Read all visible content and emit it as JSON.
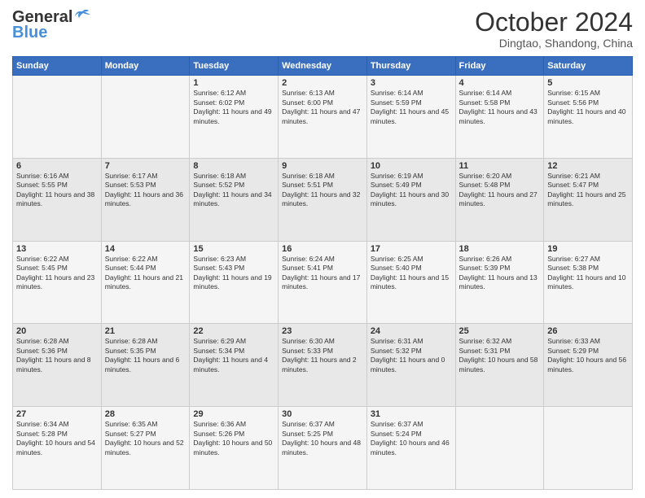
{
  "header": {
    "logo_line1": "General",
    "logo_line2": "Blue",
    "month_title": "October 2024",
    "location": "Dingtao, Shandong, China"
  },
  "days_of_week": [
    "Sunday",
    "Monday",
    "Tuesday",
    "Wednesday",
    "Thursday",
    "Friday",
    "Saturday"
  ],
  "weeks": [
    [
      {
        "day": "",
        "info": ""
      },
      {
        "day": "",
        "info": ""
      },
      {
        "day": "1",
        "info": "Sunrise: 6:12 AM\nSunset: 6:02 PM\nDaylight: 11 hours and 49 minutes."
      },
      {
        "day": "2",
        "info": "Sunrise: 6:13 AM\nSunset: 6:00 PM\nDaylight: 11 hours and 47 minutes."
      },
      {
        "day": "3",
        "info": "Sunrise: 6:14 AM\nSunset: 5:59 PM\nDaylight: 11 hours and 45 minutes."
      },
      {
        "day": "4",
        "info": "Sunrise: 6:14 AM\nSunset: 5:58 PM\nDaylight: 11 hours and 43 minutes."
      },
      {
        "day": "5",
        "info": "Sunrise: 6:15 AM\nSunset: 5:56 PM\nDaylight: 11 hours and 40 minutes."
      }
    ],
    [
      {
        "day": "6",
        "info": "Sunrise: 6:16 AM\nSunset: 5:55 PM\nDaylight: 11 hours and 38 minutes."
      },
      {
        "day": "7",
        "info": "Sunrise: 6:17 AM\nSunset: 5:53 PM\nDaylight: 11 hours and 36 minutes."
      },
      {
        "day": "8",
        "info": "Sunrise: 6:18 AM\nSunset: 5:52 PM\nDaylight: 11 hours and 34 minutes."
      },
      {
        "day": "9",
        "info": "Sunrise: 6:18 AM\nSunset: 5:51 PM\nDaylight: 11 hours and 32 minutes."
      },
      {
        "day": "10",
        "info": "Sunrise: 6:19 AM\nSunset: 5:49 PM\nDaylight: 11 hours and 30 minutes."
      },
      {
        "day": "11",
        "info": "Sunrise: 6:20 AM\nSunset: 5:48 PM\nDaylight: 11 hours and 27 minutes."
      },
      {
        "day": "12",
        "info": "Sunrise: 6:21 AM\nSunset: 5:47 PM\nDaylight: 11 hours and 25 minutes."
      }
    ],
    [
      {
        "day": "13",
        "info": "Sunrise: 6:22 AM\nSunset: 5:45 PM\nDaylight: 11 hours and 23 minutes."
      },
      {
        "day": "14",
        "info": "Sunrise: 6:22 AM\nSunset: 5:44 PM\nDaylight: 11 hours and 21 minutes."
      },
      {
        "day": "15",
        "info": "Sunrise: 6:23 AM\nSunset: 5:43 PM\nDaylight: 11 hours and 19 minutes."
      },
      {
        "day": "16",
        "info": "Sunrise: 6:24 AM\nSunset: 5:41 PM\nDaylight: 11 hours and 17 minutes."
      },
      {
        "day": "17",
        "info": "Sunrise: 6:25 AM\nSunset: 5:40 PM\nDaylight: 11 hours and 15 minutes."
      },
      {
        "day": "18",
        "info": "Sunrise: 6:26 AM\nSunset: 5:39 PM\nDaylight: 11 hours and 13 minutes."
      },
      {
        "day": "19",
        "info": "Sunrise: 6:27 AM\nSunset: 5:38 PM\nDaylight: 11 hours and 10 minutes."
      }
    ],
    [
      {
        "day": "20",
        "info": "Sunrise: 6:28 AM\nSunset: 5:36 PM\nDaylight: 11 hours and 8 minutes."
      },
      {
        "day": "21",
        "info": "Sunrise: 6:28 AM\nSunset: 5:35 PM\nDaylight: 11 hours and 6 minutes."
      },
      {
        "day": "22",
        "info": "Sunrise: 6:29 AM\nSunset: 5:34 PM\nDaylight: 11 hours and 4 minutes."
      },
      {
        "day": "23",
        "info": "Sunrise: 6:30 AM\nSunset: 5:33 PM\nDaylight: 11 hours and 2 minutes."
      },
      {
        "day": "24",
        "info": "Sunrise: 6:31 AM\nSunset: 5:32 PM\nDaylight: 11 hours and 0 minutes."
      },
      {
        "day": "25",
        "info": "Sunrise: 6:32 AM\nSunset: 5:31 PM\nDaylight: 10 hours and 58 minutes."
      },
      {
        "day": "26",
        "info": "Sunrise: 6:33 AM\nSunset: 5:29 PM\nDaylight: 10 hours and 56 minutes."
      }
    ],
    [
      {
        "day": "27",
        "info": "Sunrise: 6:34 AM\nSunset: 5:28 PM\nDaylight: 10 hours and 54 minutes."
      },
      {
        "day": "28",
        "info": "Sunrise: 6:35 AM\nSunset: 5:27 PM\nDaylight: 10 hours and 52 minutes."
      },
      {
        "day": "29",
        "info": "Sunrise: 6:36 AM\nSunset: 5:26 PM\nDaylight: 10 hours and 50 minutes."
      },
      {
        "day": "30",
        "info": "Sunrise: 6:37 AM\nSunset: 5:25 PM\nDaylight: 10 hours and 48 minutes."
      },
      {
        "day": "31",
        "info": "Sunrise: 6:37 AM\nSunset: 5:24 PM\nDaylight: 10 hours and 46 minutes."
      },
      {
        "day": "",
        "info": ""
      },
      {
        "day": "",
        "info": ""
      }
    ]
  ]
}
